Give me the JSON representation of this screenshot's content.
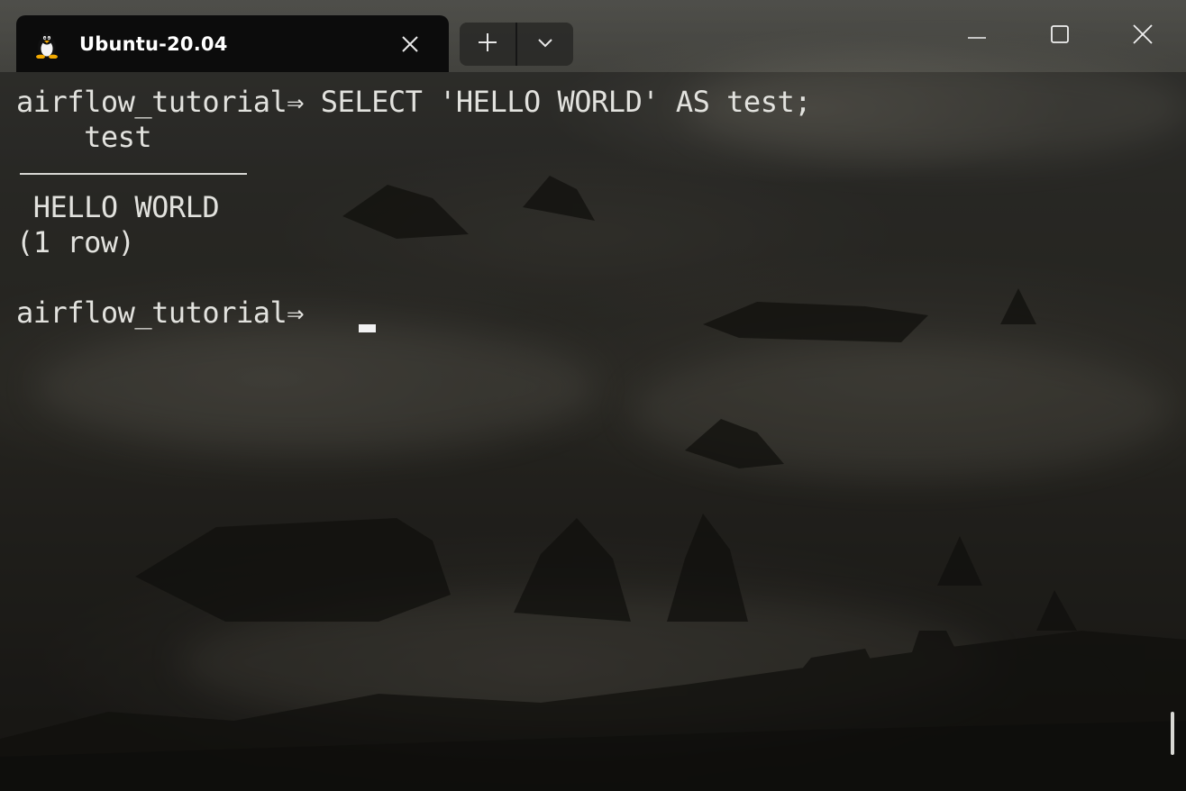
{
  "window": {
    "tab_title": "Ubuntu-20.04",
    "tab_icon": "linux-tux-icon",
    "new_tab_icon": "plus-icon",
    "dropdown_icon": "chevron-down-icon",
    "minimize_icon": "minimize-icon",
    "maximize_icon": "maximize-icon",
    "close_icon": "close-icon"
  },
  "terminal": {
    "lines": [
      "airflow_tutorial⇒ SELECT 'HELLO WORLD' AS test;",
      "    test",
      " HELLO WORLD",
      "(1 row)",
      "",
      "airflow_tutorial⇒ "
    ]
  },
  "colors": {
    "tab_background": "#0c0c0c",
    "terminal_text": "#e2e2de",
    "cursor": "#f2f2f2"
  }
}
